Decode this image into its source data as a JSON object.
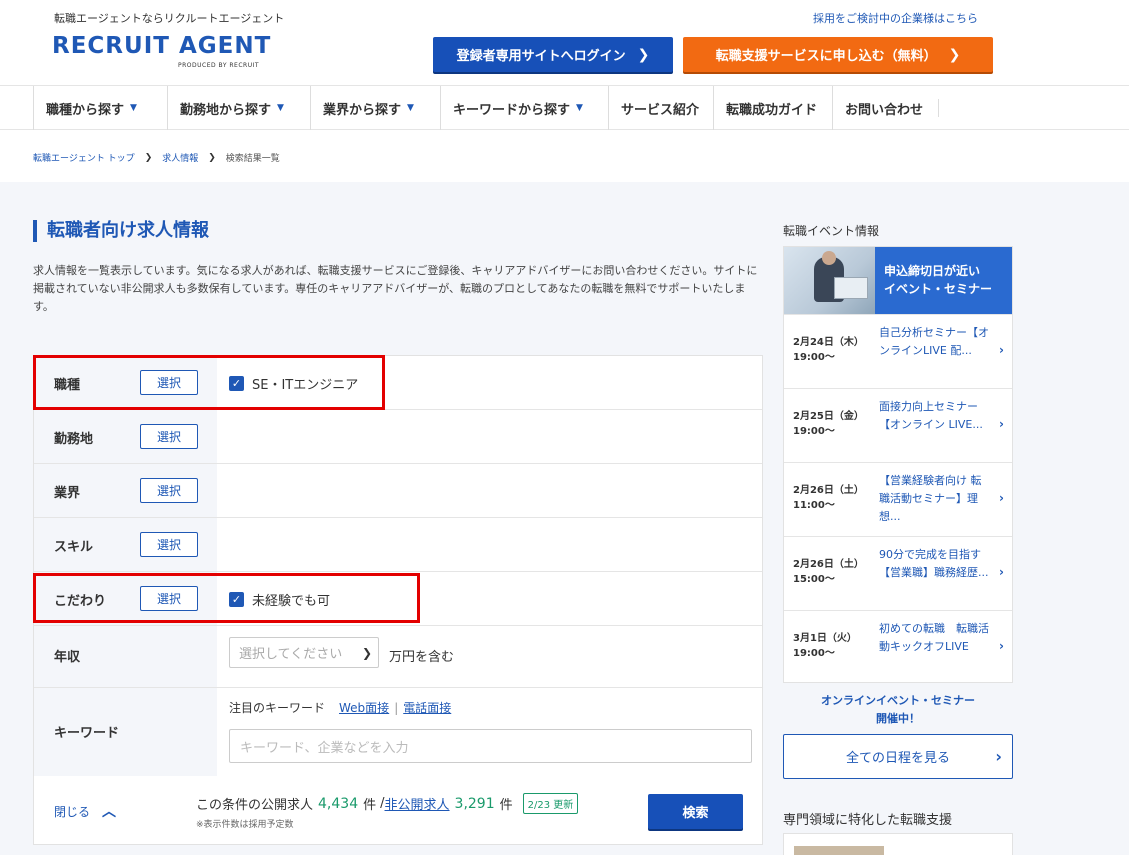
{
  "header": {
    "tagline": "転職エージェントならリクルートエージェント",
    "logo_main": "RECRUIT AGENT",
    "logo_sub": "PRODUCED BY RECRUIT",
    "corp_link": "採用をご検討中の企業様はこちら",
    "login_button": "登録者専用サイトへログイン",
    "apply_button": "転職支援サービスに申し込む（無料）"
  },
  "nav": {
    "items": [
      {
        "label": "職種から探す",
        "caret": true
      },
      {
        "label": "勤務地から探す",
        "caret": true
      },
      {
        "label": "業界から探す",
        "caret": true
      },
      {
        "label": "キーワードから探す",
        "caret": true
      },
      {
        "label": "サービス紹介",
        "caret": false
      },
      {
        "label": "転職成功ガイド",
        "caret": false
      },
      {
        "label": "お問い合わせ",
        "caret": false
      }
    ]
  },
  "breadcrumb": {
    "items": [
      "転職エージェント トップ",
      "求人情報",
      "検索結果一覧"
    ]
  },
  "main": {
    "title": "転職者向け求人情報",
    "intro": "求人情報を一覧表示しています。気になる求人があれば、転職支援サービスにご登録後、キャリアアドバイザーにお問い合わせください。サイトに掲載されていない非公開求人も多数保有しています。専任のキャリアアドバイザーが、転職のプロとしてあなたの転職を無料でサポートいたします。"
  },
  "form": {
    "select_label": "選択",
    "rows": {
      "job": {
        "label": "職種",
        "checked": "SE・ITエンジニア"
      },
      "location": {
        "label": "勤務地"
      },
      "industry": {
        "label": "業界"
      },
      "skill": {
        "label": "スキル"
      },
      "preference": {
        "label": "こだわり",
        "checked": "未経験でも可"
      },
      "income": {
        "label": "年収",
        "placeholder": "選択してください",
        "unit": "万円を含む"
      },
      "keyword": {
        "label": "キーワード",
        "featured_label": "注目のキーワード",
        "links": [
          "Web面接",
          "電話面接"
        ],
        "placeholder": "キーワード、企業などを入力"
      }
    },
    "footer": {
      "close_label": "閉じる",
      "count_prefix": "この条件の公開求人",
      "public_count": "4,434",
      "unit": "件",
      "slash": "/",
      "private_label": "非公開求人",
      "private_count": "3,291",
      "update_badge": "2/23 更新",
      "note": "※表示件数は採用予定数",
      "search_button": "検索"
    }
  },
  "sidebar": {
    "title": "転職イベント情報",
    "banner_line1": "申込締切日が近い",
    "banner_line2": "イベント・セミナー",
    "events": [
      {
        "date": "2月24日（木）",
        "time": "19:00〜",
        "name": "自己分析セミナー【オンラインLIVE 配..."
      },
      {
        "date": "2月25日（金）",
        "time": "19:00〜",
        "name": "面接力向上セミナー【オンライン LIVE..."
      },
      {
        "date": "2月26日（土）",
        "time": "11:00〜",
        "name": "【営業経験者向け 転職活動セミナー】理想..."
      },
      {
        "date": "2月26日（土）",
        "time": "15:00〜",
        "name": "90分で完成を目指す【営業職】職務経歴..."
      },
      {
        "date": "3月1日（火）",
        "time": "19:00〜",
        "name": "初めての転職　転職活動キックオフLIVE"
      }
    ],
    "online_line1": "オンラインイベント・セミナー",
    "online_line2": "開催中！",
    "all_button": "全ての日程を見る",
    "title2": "専門領域に特化した転職支援"
  },
  "colors": {
    "brand_blue": "#1f58b5",
    "orange": "#f26a12",
    "highlight_red": "#e30000",
    "count_green": "#1a9a6b"
  }
}
